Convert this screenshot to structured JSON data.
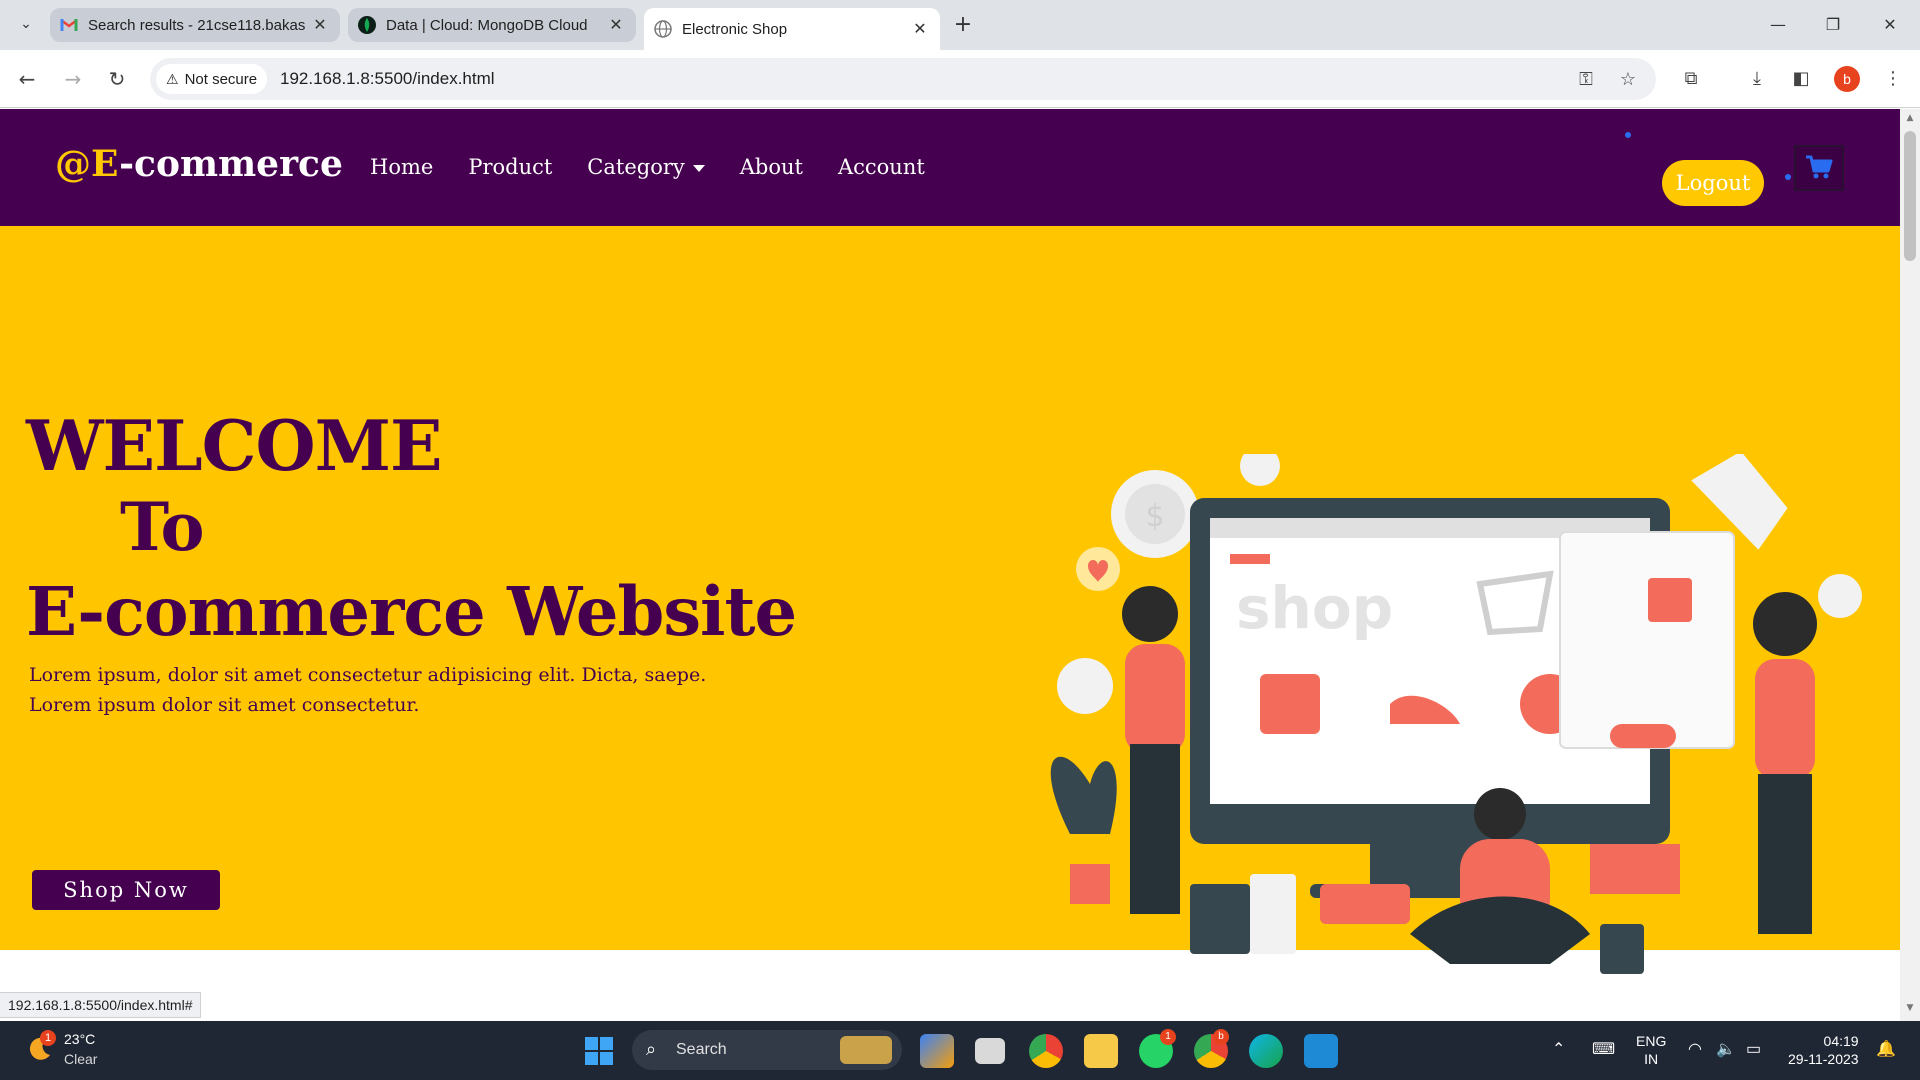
{
  "browser": {
    "tabs": [
      {
        "title": "Search results - 21cse118.bakas",
        "icon": "gmail-icon"
      },
      {
        "title": "Data | Cloud: MongoDB Cloud",
        "icon": "mongodb-icon"
      },
      {
        "title": "Electronic Shop",
        "icon": "globe-icon",
        "active": true
      }
    ],
    "security_label": "Not secure",
    "url": "192.168.1.8:5500/index.html",
    "profile_initial": "b",
    "status_url": "192.168.1.8:5500/index.html#"
  },
  "site": {
    "brand_prefix": "@E",
    "brand_suffix": "-commerce",
    "nav": [
      "Home",
      "Product",
      "Category",
      "About",
      "Account"
    ],
    "logout_label": "Logout",
    "colors": {
      "nav_bg": "#45004f",
      "hero_bg": "#ffc600",
      "accent": "#ffc800",
      "cart_icon": "#2a6cf0"
    }
  },
  "hero": {
    "line1": "WELCOME",
    "line2": "To",
    "line3": "E-commerce Website",
    "text_line1": "Lorem ipsum, dolor sit amet consectetur adipisicing elit. Dicta, saepe.",
    "text_line2": "Lorem ipsum dolor sit amet consectetur.",
    "cta": "Shop Now",
    "illustration_label": "shop"
  },
  "taskbar": {
    "temperature": "23°C",
    "condition": "Clear",
    "weather_badge": "1",
    "search_label": "Search",
    "whatsapp_badge": "1",
    "chrome_badge": "b",
    "lang_line1": "ENG",
    "lang_line2": "IN",
    "time": "04:19",
    "date": "29-11-2023"
  }
}
